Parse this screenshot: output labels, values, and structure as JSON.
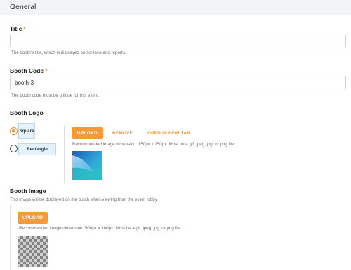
{
  "section": {
    "title": "General"
  },
  "title_field": {
    "label": "Title",
    "required_mark": "*",
    "value": "",
    "help": "The booth's title, which is displayed on screens and reports."
  },
  "booth_code": {
    "label": "Booth Code",
    "required_mark": "*",
    "value": "booth-3",
    "help": "The booth code must be unique for this event."
  },
  "booth_logo": {
    "label": "Booth Logo",
    "shapes": [
      {
        "label": "Square",
        "selected": true
      },
      {
        "label": "Rectangle",
        "selected": false
      }
    ],
    "upload_label": "UPLOAD",
    "remove_label": "REMOVE",
    "open_label": "OPEN IN NEW TAB",
    "help": "Recommended image dimension: 150px x 150px. Must be a gif, jpeg, jpg, or png file."
  },
  "booth_image": {
    "label": "Booth Image",
    "description": "This image will be displayed on the booth when viewing from the event lobby",
    "upload_label": "UPLOAD",
    "help": "Recommended image dimension: 500px x 300px. Must be a gif, jpeg, jpg, or png file."
  },
  "colors": {
    "accent": "#f49a3a",
    "chip_bg": "#e6f2fb"
  }
}
